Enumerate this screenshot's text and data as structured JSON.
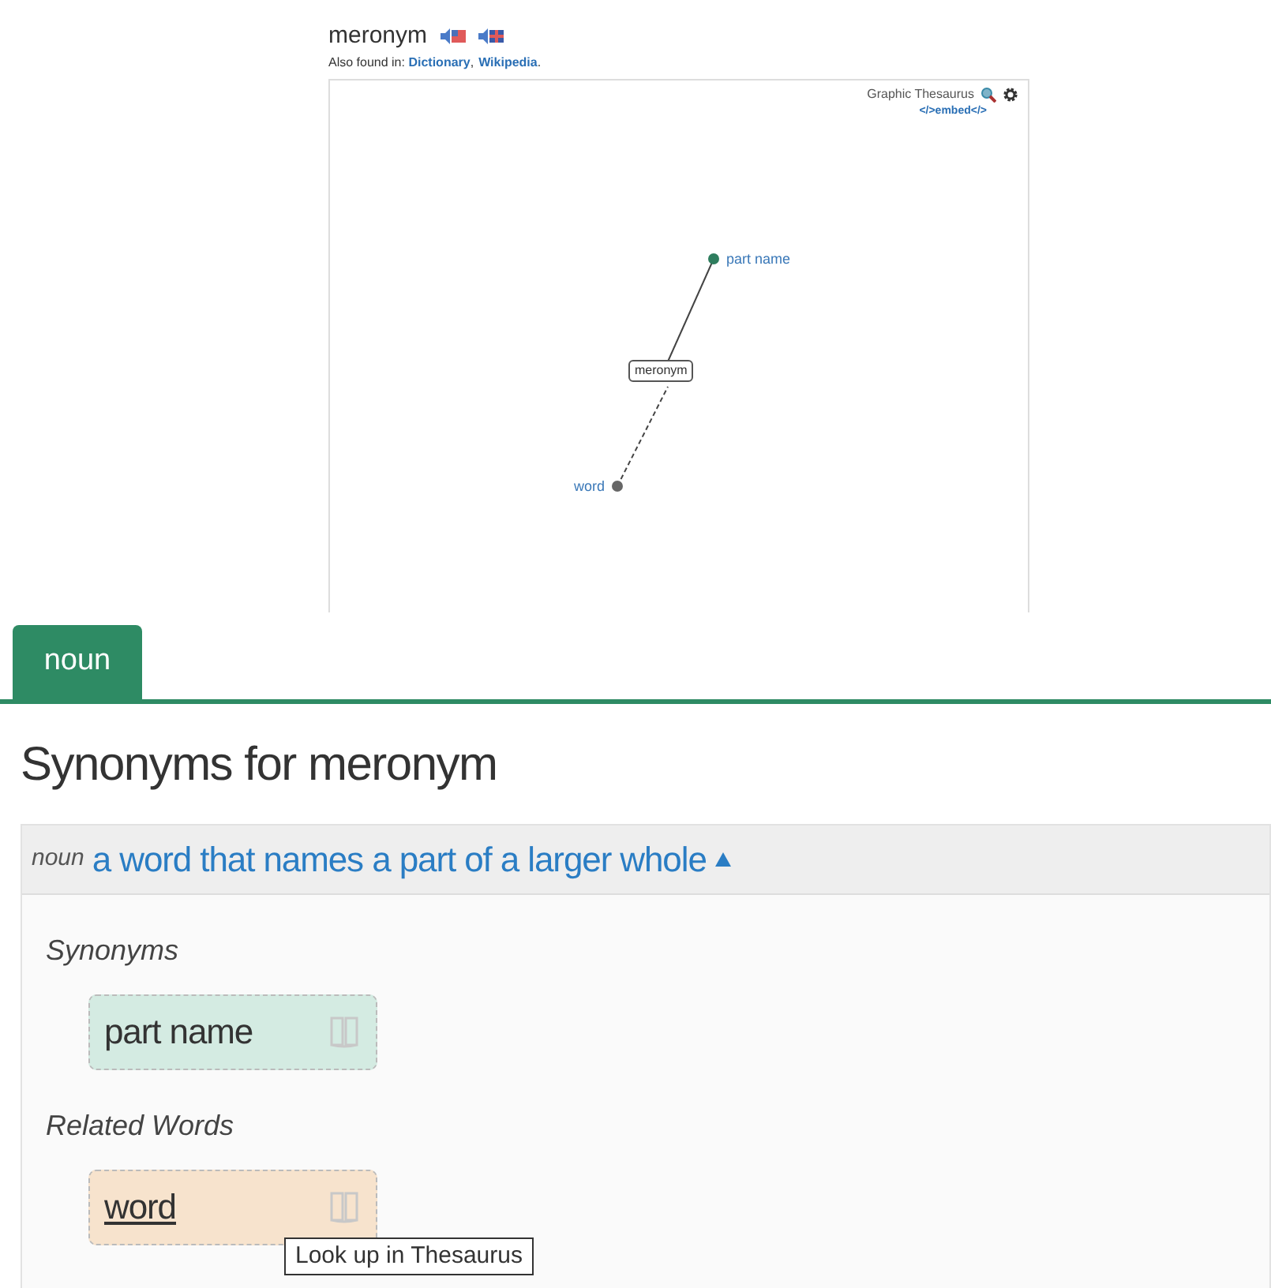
{
  "header": {
    "word": "meronym",
    "also_found_label": "Also found in:",
    "also_found_links": [
      {
        "text": "Dictionary",
        "after": ","
      },
      {
        "text": "Wikipedia",
        "after": "."
      }
    ]
  },
  "graph": {
    "title": "Graphic Thesaurus",
    "embed": "</>embed</>",
    "center": "meronym",
    "nodes": [
      {
        "label": "part name",
        "kind": "synonym"
      },
      {
        "label": "word",
        "kind": "related"
      }
    ]
  },
  "tabs": [
    {
      "label": "noun",
      "selected": true
    }
  ],
  "heading": "Synonyms for meronym",
  "sense": {
    "pos": "noun",
    "definition": "a word that names a part of a larger whole",
    "expanded": true,
    "groups": [
      {
        "title": "Synonyms",
        "kind": "synonym",
        "words": [
          {
            "text": "part name",
            "hovered": false
          }
        ]
      },
      {
        "title": "Related Words",
        "kind": "related",
        "words": [
          {
            "text": "word",
            "hovered": true
          }
        ]
      }
    ]
  },
  "tooltip": "Look up in Thesaurus"
}
